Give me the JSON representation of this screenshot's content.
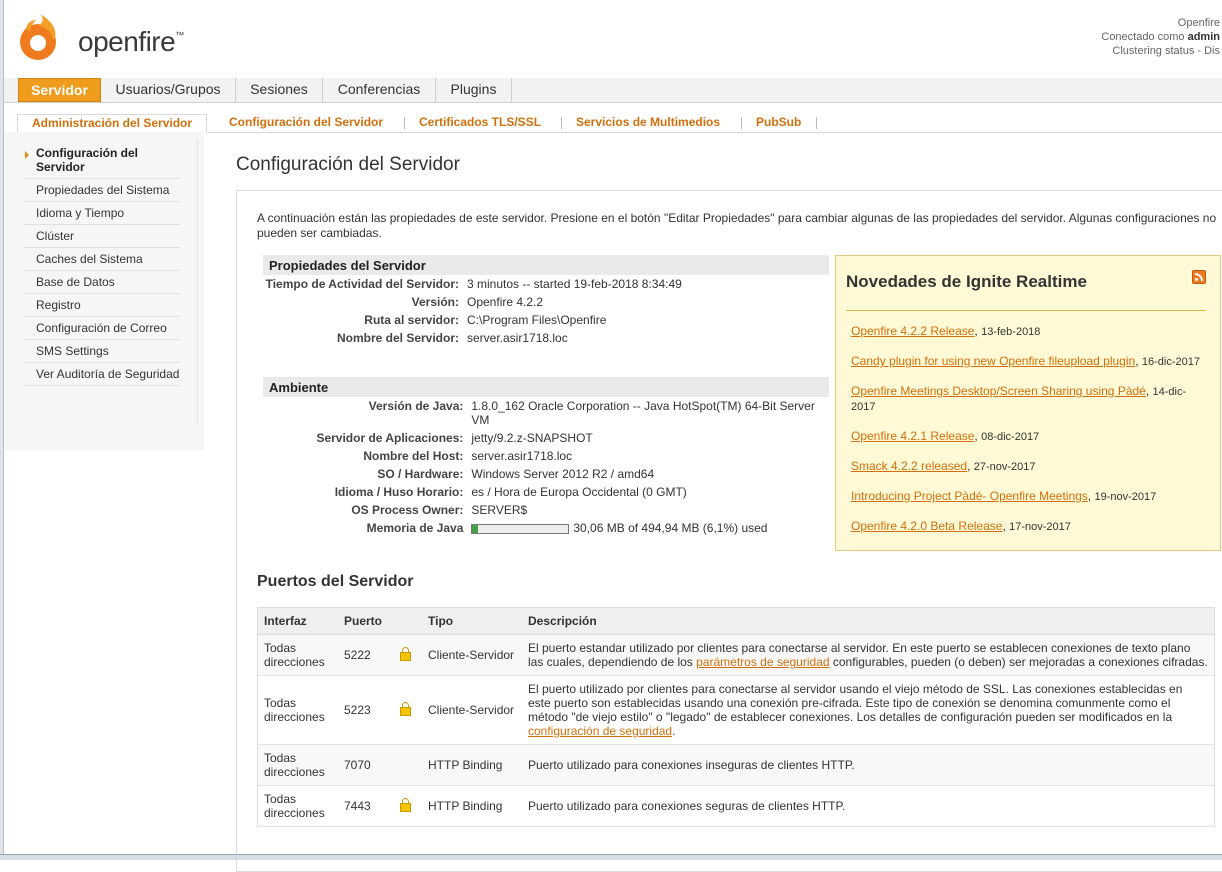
{
  "header": {
    "app_name": "openfire",
    "app_tm": "™",
    "info_line1": "Openfire",
    "connected_prefix": "Conectado como ",
    "connected_user": "admin",
    "clustering": "Clustering status - Dis"
  },
  "main_tabs": [
    "Servidor",
    "Usuarios/Grupos",
    "Sesiones",
    "Conferencias",
    "Plugins"
  ],
  "sub_tabs": [
    "Administración del Servidor",
    "Configuración del Servidor",
    "Certificados TLS/SSL",
    "Servicios de Multimedios",
    "PubSub"
  ],
  "sidebar": {
    "items": [
      "Configuración del Servidor",
      "Propiedades del Sistema",
      "Idioma y Tiempo",
      "Clúster",
      "Caches del Sistema",
      "Base de Datos",
      "Registro",
      "Configuración de Correo",
      "SMS Settings",
      "Ver Auditoría de Seguridad"
    ]
  },
  "page": {
    "title": "Configuración del Servidor",
    "intro": "A continuación están las propiedades de este servidor. Presione en el botón \"Editar Propiedades\" para cambiar algunas de las propiedades del servidor. Algunas configuraciones no pueden ser cambiadas."
  },
  "server_props": {
    "title": "Propiedades del Servidor",
    "rows": [
      {
        "label": "Tiempo de Actividad del Servidor:",
        "value": "3 minutos -- started 19-feb-2018 8:34:49"
      },
      {
        "label": "Versión:",
        "value": "Openfire 4.2.2"
      },
      {
        "label": "Ruta al servidor:",
        "value": "C:\\Program Files\\Openfire"
      },
      {
        "label": "Nombre del Servidor:",
        "value": "server.asir1718.loc"
      }
    ]
  },
  "environment": {
    "title": "Ambiente",
    "rows": [
      {
        "label": "Versión de Java:",
        "value": "1.8.0_162 Oracle Corporation -- Java HotSpot(TM) 64-Bit Server VM"
      },
      {
        "label": "Servidor de Aplicaciones:",
        "value": "jetty/9.2.z-SNAPSHOT"
      },
      {
        "label": "Nombre del Host:",
        "value": "server.asir1718.loc"
      },
      {
        "label": "SO / Hardware:",
        "value": "Windows Server 2012 R2 / amd64"
      },
      {
        "label": "Idioma / Huso Horario:",
        "value": "es / Hora de Europa Occidental (0 GMT)"
      },
      {
        "label": "OS Process Owner:",
        "value": "SERVER$"
      }
    ],
    "memory_label": "Memoria de Java",
    "memory_text": "30,06 MB of 494,94 MB (6,1%) used",
    "memory_fraction": 0.061
  },
  "news": {
    "title": "Novedades de Ignite Realtime",
    "items": [
      {
        "link": "Openfire 4.2.2 Release",
        "date": "13-feb-2018"
      },
      {
        "link": "Candy plugin for using new Openfire fileupload plugin",
        "date": "16-dic-2017"
      },
      {
        "link": "Openfire Meetings Desktop/Screen Sharing using Pàdé",
        "date": "14-dic-2017"
      },
      {
        "link": "Openfire 4.2.1 Release",
        "date": "08-dic-2017"
      },
      {
        "link": "Smack 4.2.2 released",
        "date": "27-nov-2017"
      },
      {
        "link": "Introducing Project Pàdé- Openfire Meetings",
        "date": "19-nov-2017"
      },
      {
        "link": "Openfire 4.2.0 Beta Release",
        "date": "17-nov-2017"
      }
    ]
  },
  "ports": {
    "title": "Puertos del Servidor",
    "headers": [
      "Interfaz",
      "Puerto",
      "Tipo",
      "Descripción"
    ],
    "rows": [
      {
        "interface": "Todas direcciones",
        "port": "5222",
        "secure": true,
        "type": "Cliente-Servidor",
        "desc_before": "El puerto estandar utilizado por clientes para conectarse al servidor. En este puerto se establecen conexiones de texto plano las cuales, dependiendo de los ",
        "desc_link": "parámetros de seguridad",
        "desc_after": " configurables, pueden (o deben) ser mejoradas a conexiones cifradas."
      },
      {
        "interface": "Todas direcciones",
        "port": "5223",
        "secure": true,
        "type": "Cliente-Servidor",
        "desc_before": "El puerto utilizado por clientes para conectarse al servidor usando el viejo método de SSL. Las conexiones establecidas en este puerto son establecidas usando una conexión pre-cifrada. Este tipo de conexión se denomina comunmente como el método \"de viejo estilo\" o \"legado\" de establecer conexiones. Los detalles de configuración pueden ser modificados en la ",
        "desc_link": "configuración de seguridad",
        "desc_after": "."
      },
      {
        "interface": "Todas direcciones",
        "port": "7070",
        "secure": false,
        "type": "HTTP Binding",
        "desc_before": "Puerto utilizado para conexiones inseguras de clientes HTTP.",
        "desc_link": "",
        "desc_after": ""
      },
      {
        "interface": "Todas direcciones",
        "port": "7443",
        "secure": true,
        "type": "HTTP Binding",
        "desc_before": "Puerto utilizado para conexiones seguras de clientes HTTP.",
        "desc_link": "",
        "desc_after": ""
      }
    ]
  },
  "colors": {
    "accent": "#ef9b1c",
    "link": "#d26f0a",
    "news_bg": "#fff9d6"
  }
}
